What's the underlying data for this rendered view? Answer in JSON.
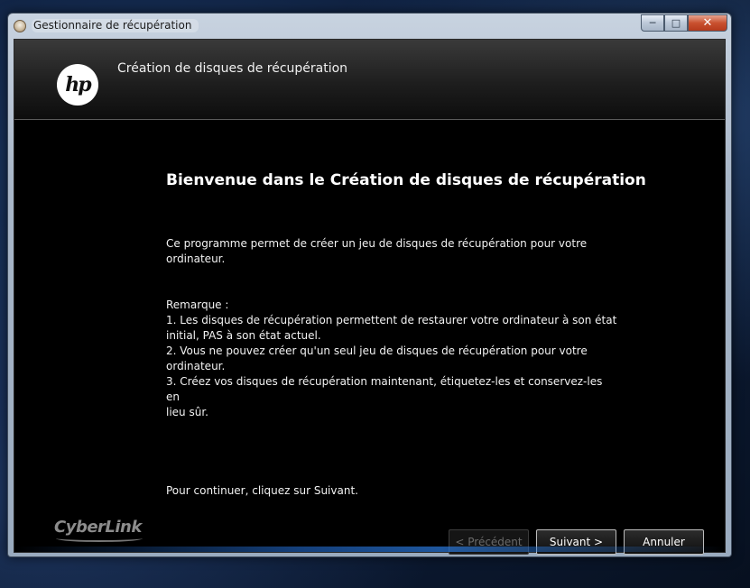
{
  "window": {
    "title": "Gestionnaire de récupération",
    "icon": "recovery-manager-icon",
    "caption_buttons": {
      "minimize": "─",
      "maximize": "□",
      "close": "✕"
    }
  },
  "header": {
    "logo_text": "hp",
    "title": "Création de disques de récupération"
  },
  "content": {
    "welcome": "Bienvenue dans le Création de disques de récupération",
    "intro_line1": "Ce programme permet de créer un jeu de disques de récupération pour votre",
    "intro_line2": "ordinateur.",
    "remark_label": "Remarque :",
    "remarks": [
      "1. Les disques de récupération permettent de restaurer votre ordinateur à son état",
      "initial, PAS à son état actuel.",
      "2. Vous ne pouvez créer qu'un seul jeu de disques de récupération pour votre",
      "ordinateur.",
      "3. Créez vos disques de récupération maintenant, étiquetez-les et conservez-les en",
      "lieu sûr."
    ],
    "continue_text": "Pour continuer, cliquez sur Suivant."
  },
  "footer": {
    "brand": "CyberLink",
    "buttons": {
      "previous": "< Précédent",
      "next": "Suivant >",
      "cancel": "Annuler"
    }
  },
  "colors": {
    "client_background": "#000000",
    "text": "#f2f2f2",
    "disabled_text": "#6a6a6a",
    "close_button": "#c9502f"
  }
}
